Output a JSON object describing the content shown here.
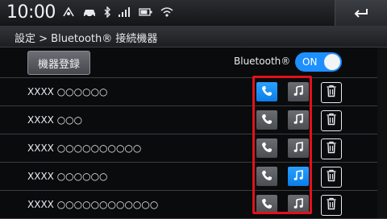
{
  "status": {
    "time": "10:00",
    "icons": [
      "gps-icon",
      "car-icon",
      "bluetooth-icon",
      "signal-icon",
      "battery-icon",
      "wifi-icon"
    ]
  },
  "header": {
    "breadcrumb": "設定 > Bluetooth® 接続機器"
  },
  "toolbar": {
    "register_label": "機器登録",
    "bluetooth_label": "Bluetooth®",
    "toggle_label": "ON"
  },
  "devices": [
    {
      "name": "XXXX ○○○○○○",
      "phone_active": true,
      "music_active": false
    },
    {
      "name": "XXXX ○○○",
      "phone_active": false,
      "music_active": false
    },
    {
      "name": "XXXX ○○○○○○○○○○",
      "phone_active": false,
      "music_active": false
    },
    {
      "name": "XXXX ○○○○○○",
      "phone_active": false,
      "music_active": true
    },
    {
      "name": "XXXX ○○○○○○○○○○○○",
      "phone_active": false,
      "music_active": false
    }
  ],
  "colors": {
    "accent": "#1e8fff",
    "highlight": "#e0121a"
  }
}
